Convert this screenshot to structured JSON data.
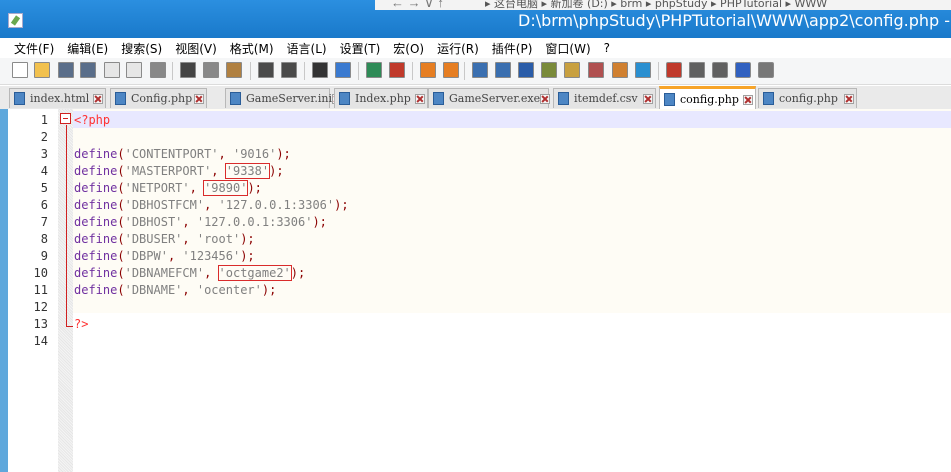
{
  "window": {
    "title": "D:\\brm\\phpStudy\\PHPTutorial\\WWW\\app2\\config.php - No",
    "explorer_nav": "← → ∨ ↑",
    "explorer_breadcrumb": "▸ 这台电脑 ▸ 新加卷 (D:) ▸ brm ▸ phpStudy ▸ PHPTutorial ▸ WWW"
  },
  "menu": [
    "文件(F)",
    "编辑(E)",
    "搜索(S)",
    "视图(V)",
    "格式(M)",
    "语言(L)",
    "设置(T)",
    "宏(O)",
    "运行(R)",
    "插件(P)",
    "窗口(W)",
    "?"
  ],
  "toolbar_icons": [
    "new-file-icon",
    "open-file-icon",
    "save-icon",
    "save-all-icon",
    "close-icon",
    "close-all-icon",
    "print-icon",
    "cut-icon",
    "copy-icon",
    "paste-icon",
    "undo-icon",
    "redo-icon",
    "find-icon",
    "replace-icon",
    "zoom-in-icon",
    "zoom-out-icon",
    "sync-vertical-icon",
    "sync-horizontal-icon",
    "word-wrap-icon",
    "show-all-chars-icon",
    "indent-guide-icon",
    "user-language-icon",
    "map-icon",
    "function-list-icon",
    "folder-workspace-icon",
    "monitoring-icon",
    "record-macro-icon",
    "stop-record-icon",
    "play-macro-icon",
    "run-macro-multiple-icon",
    "save-macro-icon"
  ],
  "tabs": [
    {
      "label": "index.html",
      "active": false
    },
    {
      "label": "Config.php",
      "active": false
    },
    {
      "label": "GameServer.ini",
      "active": false
    },
    {
      "label": "Index.php",
      "active": false
    },
    {
      "label": "GameServer.exe",
      "active": false
    },
    {
      "label": "itemdef.csv",
      "active": false
    },
    {
      "label": "config.php",
      "active": true
    },
    {
      "label": "config.php",
      "active": false
    }
  ],
  "editor": {
    "lines": [
      {
        "no": "1",
        "parts": [
          {
            "t": "<?php",
            "c": "tag"
          }
        ]
      },
      {
        "no": "2",
        "parts": []
      },
      {
        "no": "3",
        "parts": [
          {
            "t": "define",
            "c": "kw"
          },
          {
            "t": "(",
            "c": "pun"
          },
          {
            "t": "'CONTENTPORT'",
            "c": "str"
          },
          {
            "t": ", ",
            "c": "pun"
          },
          {
            "t": "'9016'",
            "c": "str"
          },
          {
            "t": ");",
            "c": "pun"
          }
        ]
      },
      {
        "no": "4",
        "parts": [
          {
            "t": "define",
            "c": "kw"
          },
          {
            "t": "(",
            "c": "pun"
          },
          {
            "t": "'MASTERPORT'",
            "c": "str"
          },
          {
            "t": ", ",
            "c": "pun"
          },
          {
            "t": "'9338'",
            "c": "str",
            "hl": true
          },
          {
            "t": ");",
            "c": "pun"
          }
        ]
      },
      {
        "no": "5",
        "parts": [
          {
            "t": "define",
            "c": "kw"
          },
          {
            "t": "(",
            "c": "pun"
          },
          {
            "t": "'NETPORT'",
            "c": "str"
          },
          {
            "t": ", ",
            "c": "pun"
          },
          {
            "t": "'9890'",
            "c": "str",
            "hl": true
          },
          {
            "t": ");",
            "c": "pun"
          }
        ]
      },
      {
        "no": "6",
        "parts": [
          {
            "t": "define",
            "c": "kw"
          },
          {
            "t": "(",
            "c": "pun"
          },
          {
            "t": "'DBHOSTFCM'",
            "c": "str"
          },
          {
            "t": ", ",
            "c": "pun"
          },
          {
            "t": "'127.0.0.1:3306'",
            "c": "str"
          },
          {
            "t": ");",
            "c": "pun"
          }
        ]
      },
      {
        "no": "7",
        "parts": [
          {
            "t": "define",
            "c": "kw"
          },
          {
            "t": "(",
            "c": "pun"
          },
          {
            "t": "'DBHOST'",
            "c": "str"
          },
          {
            "t": ", ",
            "c": "pun"
          },
          {
            "t": "'127.0.0.1:3306'",
            "c": "str"
          },
          {
            "t": ");",
            "c": "pun"
          }
        ]
      },
      {
        "no": "8",
        "parts": [
          {
            "t": "define",
            "c": "kw"
          },
          {
            "t": "(",
            "c": "pun"
          },
          {
            "t": "'DBUSER'",
            "c": "str"
          },
          {
            "t": ", ",
            "c": "pun"
          },
          {
            "t": "'root'",
            "c": "str"
          },
          {
            "t": ");",
            "c": "pun"
          }
        ]
      },
      {
        "no": "9",
        "parts": [
          {
            "t": "define",
            "c": "kw"
          },
          {
            "t": "(",
            "c": "pun"
          },
          {
            "t": "'DBPW'",
            "c": "str"
          },
          {
            "t": ", ",
            "c": "pun"
          },
          {
            "t": "'123456'",
            "c": "str"
          },
          {
            "t": ");",
            "c": "pun"
          }
        ]
      },
      {
        "no": "10",
        "parts": [
          {
            "t": "define",
            "c": "kw"
          },
          {
            "t": "(",
            "c": "pun"
          },
          {
            "t": "'DBNAMEFCM'",
            "c": "str"
          },
          {
            "t": ", ",
            "c": "pun"
          },
          {
            "t": "'octgame2'",
            "c": "str",
            "hl": true
          },
          {
            "t": ");",
            "c": "pun"
          }
        ]
      },
      {
        "no": "11",
        "parts": [
          {
            "t": "define",
            "c": "kw"
          },
          {
            "t": "(",
            "c": "pun"
          },
          {
            "t": "'DBNAME'",
            "c": "str"
          },
          {
            "t": ", ",
            "c": "pun"
          },
          {
            "t": "'ocenter'",
            "c": "str"
          },
          {
            "t": ");",
            "c": "pun"
          }
        ]
      },
      {
        "no": "12",
        "parts": []
      },
      {
        "no": "13",
        "parts": [
          {
            "t": "?>",
            "c": "tag"
          }
        ]
      },
      {
        "no": "14",
        "parts": []
      }
    ]
  },
  "colors": {
    "titlebar": "#1f86d6",
    "keyword": "#7030a0",
    "string": "#808080",
    "php_tag": "#ff3333",
    "highlight_box": "#d92b2b",
    "active_tab_accent": "#f7a428"
  }
}
